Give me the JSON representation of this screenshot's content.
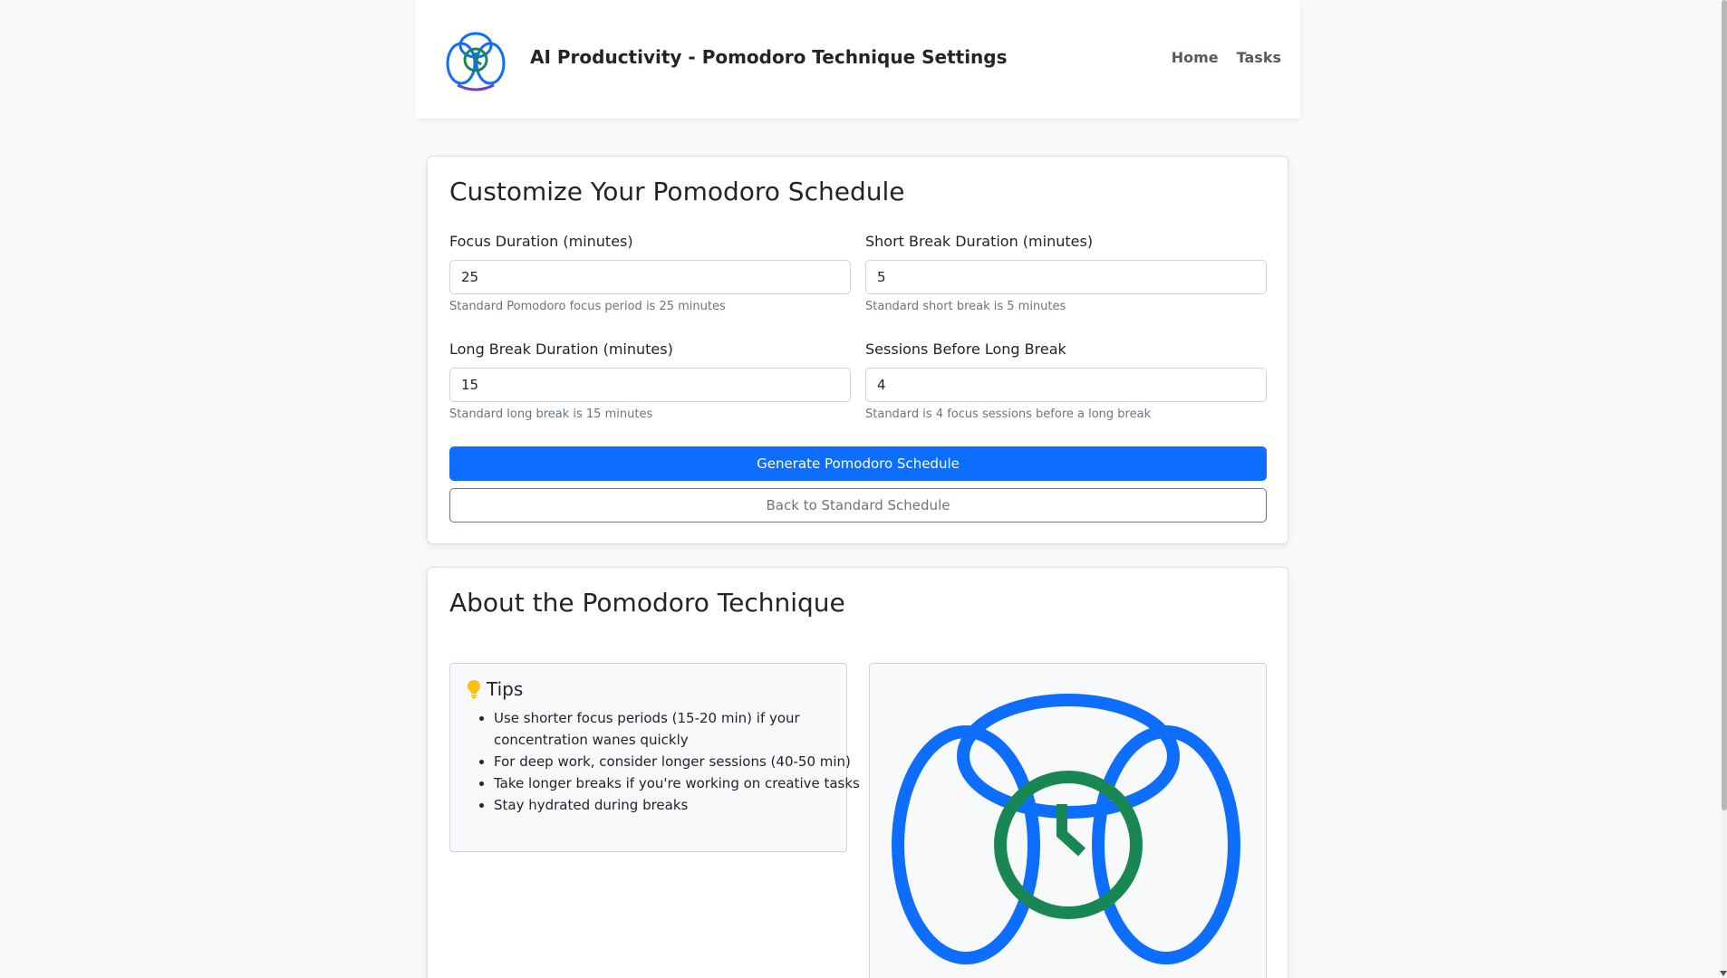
{
  "header": {
    "title": "AI Productivity - Pomodoro Technique Settings",
    "nav": [
      "Home",
      "Tasks"
    ],
    "logo_icon": "pomodoro-logo-icon"
  },
  "settings": {
    "heading": "Customize Your Pomodoro Schedule",
    "fields": [
      {
        "label": "Focus Duration (minutes)",
        "value": "25",
        "help": "Standard Pomodoro focus period is 25 minutes"
      },
      {
        "label": "Short Break Duration (minutes)",
        "value": "5",
        "help": "Standard short break is 5 minutes"
      },
      {
        "label": "Long Break Duration (minutes)",
        "value": "15",
        "help": "Standard long break is 15 minutes"
      },
      {
        "label": "Sessions Before Long Break",
        "value": "4",
        "help": "Standard is 4 focus sessions before a long break"
      }
    ],
    "generate_button": "Generate Pomodoro Schedule",
    "back_button": "Back to Standard Schedule"
  },
  "about": {
    "heading": "About the Pomodoro Technique",
    "tips_title": "Tips",
    "tips_icon": "lightbulb-icon",
    "tips": [
      "Use shorter focus periods (15-20 min) if your concentration wanes quickly",
      "For deep work, consider longer sessions (40-50 min)",
      "Take longer breaks if you're working on creative tasks",
      "Stay hydrated during breaks"
    ],
    "illustration_icon": "pomodoro-clock-illustration-icon"
  },
  "colors": {
    "primary": "#0d6efd",
    "logo_blue": "#0d6efd",
    "logo_green": "#198754",
    "logo_purple": "#6f42c1",
    "bulb_yellow": "#ffc107"
  }
}
